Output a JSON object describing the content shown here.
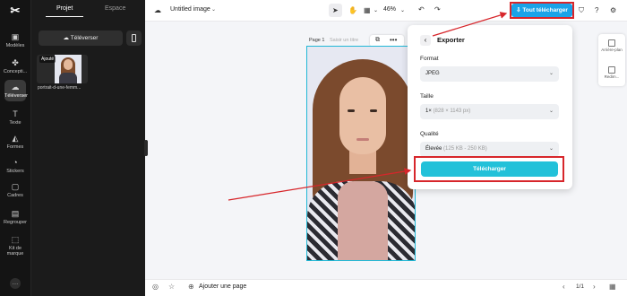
{
  "rail": {
    "items": [
      {
        "label": "Modèles",
        "icon": "templates-icon"
      },
      {
        "label": "Concepti...",
        "icon": "design-icon"
      },
      {
        "label": "Téléverser",
        "icon": "upload-cloud-icon"
      },
      {
        "label": "Texte",
        "icon": "text-icon"
      },
      {
        "label": "Formes",
        "icon": "shapes-icon"
      },
      {
        "label": "Stickers",
        "icon": "sticker-icon"
      },
      {
        "label": "Cadres",
        "icon": "frame-icon"
      },
      {
        "label": "Regrouper",
        "icon": "group-icon"
      },
      {
        "label": "Kit de marque",
        "icon": "brand-kit-icon"
      }
    ],
    "active_index": 2
  },
  "panel": {
    "tabs": [
      "Projet",
      "Espace"
    ],
    "upload_label": "Téléverser",
    "asset": {
      "badge": "Ajouté",
      "name": "portrait-d-une-femm..."
    }
  },
  "topbar": {
    "doc_title": "Untitled image",
    "zoom": "46%",
    "export_all_label": "Tout télécharger"
  },
  "canvas": {
    "page_label": "Page 1",
    "page_title_placeholder": "Saisir un titre"
  },
  "mini_panel": {
    "items": [
      "Arrière-plan",
      "Redim..."
    ]
  },
  "export": {
    "title": "Exporter",
    "format_label": "Format",
    "format_value": "JPEG",
    "size_label": "Taille",
    "size_value": "1×",
    "size_detail": "(828 × 1143 px)",
    "quality_label": "Qualité",
    "quality_value": "Élevée",
    "quality_detail": "(125 KB - 250 KB)",
    "download_label": "Télécharger"
  },
  "bottombar": {
    "add_page_label": "Ajouter une page",
    "pager": "1/1"
  },
  "colors": {
    "accent": "#22c1d9",
    "export_all": "#1aa3e8",
    "highlight": "#d7262b"
  }
}
